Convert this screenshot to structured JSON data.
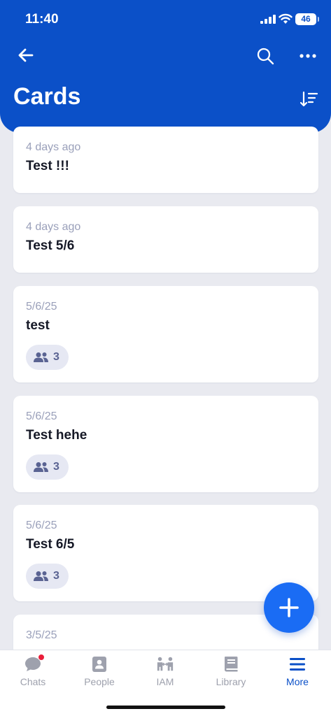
{
  "status_bar": {
    "time": "11:40",
    "battery": "46"
  },
  "header": {
    "title": "Cards",
    "back_icon": "arrow-left-icon",
    "search_icon": "search-icon",
    "more_icon": "ellipsis-icon",
    "sort_icon": "sort-icon"
  },
  "cards": [
    {
      "date": "4 days ago",
      "title": "Test !!!",
      "members": null
    },
    {
      "date": "4 days ago",
      "title": "Test 5/6",
      "members": null
    },
    {
      "date": "5/6/25",
      "title": "test",
      "members": "3"
    },
    {
      "date": "5/6/25",
      "title": "Test hehe",
      "members": "3"
    },
    {
      "date": "5/6/25",
      "title": "Test 6/5",
      "members": "3"
    },
    {
      "date": "3/5/25",
      "title": "",
      "members": null
    }
  ],
  "fab": {
    "icon": "plus-icon"
  },
  "tabbar": {
    "items": [
      {
        "label": "Chats",
        "icon": "chat-bubble-icon",
        "active": false,
        "badge": true
      },
      {
        "label": "People",
        "icon": "contacts-icon",
        "active": false
      },
      {
        "label": "IAM",
        "icon": "iam-people-icon",
        "active": false
      },
      {
        "label": "Library",
        "icon": "book-icon",
        "active": false
      },
      {
        "label": "More",
        "icon": "menu-icon",
        "active": true
      }
    ]
  },
  "colors": {
    "brand": "#0b50c8",
    "fab": "#1a6cf4",
    "badge": "#ea1e3a"
  }
}
